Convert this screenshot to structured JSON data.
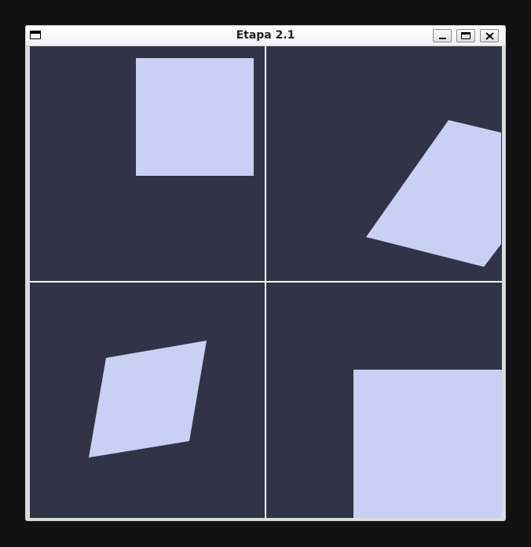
{
  "window": {
    "title": "Etapa 2.1",
    "icons": {
      "app": "window-icon",
      "minimize": "minimize-icon",
      "maximize": "maximize-icon",
      "close": "close-icon"
    }
  },
  "colors": {
    "viewport_background": "#313447",
    "shape_fill": "#c8d1f3",
    "divider": "#ffffff",
    "desktop": "#111111"
  }
}
